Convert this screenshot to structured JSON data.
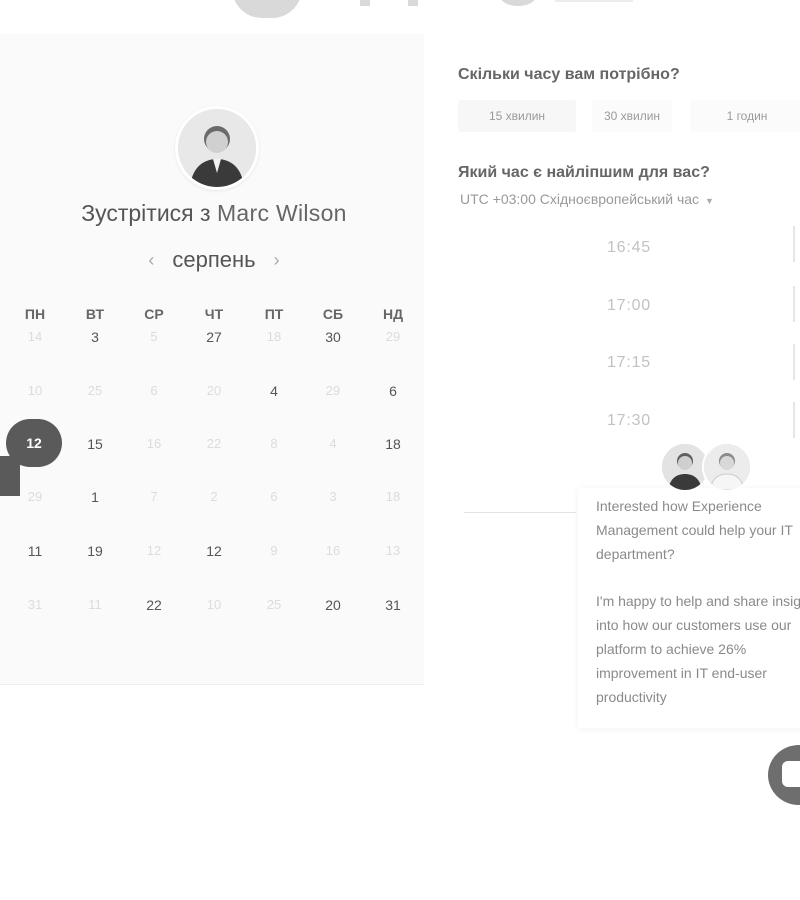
{
  "host_name": "Marc Wilson",
  "calendar": {
    "title_prefix": "Зустрітися з",
    "month": "серпень",
    "prev_month_icon": "chevron-left-icon",
    "next_month_icon": "chevron-right-icon",
    "weekdays": [
      "ПН",
      "ВТ",
      "СР",
      "ЧТ",
      "ПТ",
      "СБ",
      "НД"
    ],
    "selected_day": "12",
    "weeks": [
      [
        "14",
        "3",
        "5",
        "27",
        "18",
        "30",
        "29"
      ],
      [
        "10",
        "25",
        "6",
        "20",
        "4",
        "29",
        "6"
      ],
      [
        "12",
        "15",
        "16",
        "22",
        "8",
        "4",
        "18"
      ],
      [
        "29",
        "1",
        "7",
        "2",
        "6",
        "3",
        "18"
      ],
      [
        "11",
        "19",
        "12",
        "12",
        "9",
        "16",
        "13"
      ],
      [
        "31",
        "11",
        "22",
        "10",
        "25",
        "20",
        "31"
      ]
    ],
    "available": [
      [
        false,
        true,
        false,
        true,
        false,
        true,
        false
      ],
      [
        false,
        false,
        false,
        false,
        true,
        false,
        true
      ],
      [
        true,
        true,
        false,
        false,
        false,
        false,
        true
      ],
      [
        false,
        true,
        false,
        false,
        false,
        false,
        false
      ],
      [
        true,
        true,
        false,
        true,
        false,
        false,
        false
      ],
      [
        false,
        false,
        true,
        false,
        false,
        true,
        true
      ]
    ]
  },
  "duration": {
    "question": "Скільки часу вам потрібно?",
    "options": [
      "15 хвилин",
      "30 хвилин",
      "1 годин"
    ],
    "selected_index": 0
  },
  "time": {
    "question": "Який час є найліпшим для вас?",
    "timezone": "UTC +03:00 Східноєвропейський час",
    "timezone_caret_icon": "caret-down-icon",
    "slots": [
      "16:45",
      "17:00",
      "17:15",
      "17:30"
    ]
  },
  "chat": {
    "message_1": "Interested how Experience Management could help your IT department?",
    "message_2": "I'm happy to help and share insight into how our customers use our platform to achieve 26% improvement in IT end-user productivity",
    "launcher_icon": "chat-bubble-icon"
  },
  "colors": {
    "selected_day_bg": "#5a5a5a",
    "panel_bg": "#fafafa",
    "chip_bg": "#f7f7f7"
  }
}
